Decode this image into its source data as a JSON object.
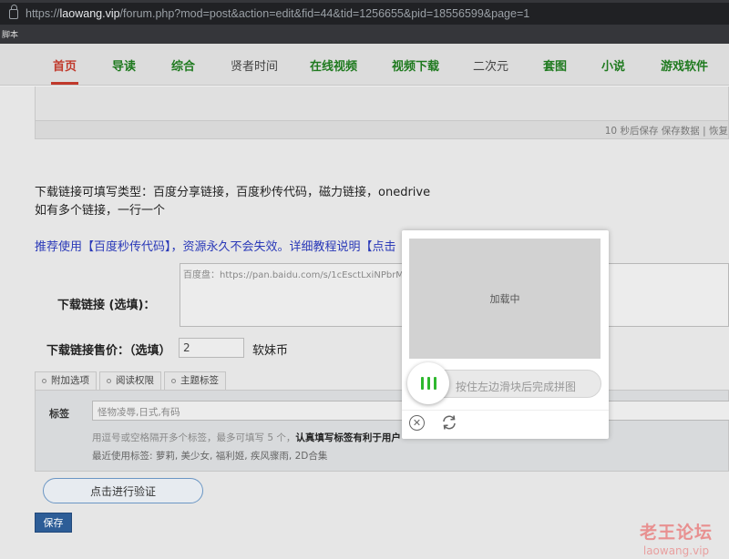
{
  "browser": {
    "url_host": "laowang.vip",
    "url_scheme": "https://",
    "url_rest": "/forum.php?mod=post&action=edit&fid=44&tid=1256655&pid=18556599&page=1",
    "bookmark_text": "脚本"
  },
  "nav": {
    "items": [
      {
        "label": "首页"
      },
      {
        "label": "导读"
      },
      {
        "label": "综合"
      },
      {
        "label": "贤者时间"
      },
      {
        "label": "在线视频"
      },
      {
        "label": "视频下载"
      },
      {
        "label": "二次元"
      },
      {
        "label": "套图"
      },
      {
        "label": "小说"
      },
      {
        "label": "游戏软件"
      }
    ]
  },
  "editor": {
    "save_status": "10 秒后保存 保存数据 | 恢复"
  },
  "download": {
    "types_text": "下载链接可填写类型：百度分享链接，百度秒传代码，磁力链接，onedrive",
    "multi_text": "如有多个链接，一行一个",
    "recommend_text": "推荐使用【百度秒传代码】，资源永久不会失效。详细教程说明【点击",
    "link_label": "下载链接 (选填)：",
    "link_placeholder": "百度盘：https://pan.baidu.com/s/1cEsctLxiNPbrM2-r",
    "price_label": "下载链接售价：（选填）",
    "price_value": "2",
    "price_unit": "软妹币"
  },
  "tabs": [
    {
      "label": "附加选项"
    },
    {
      "label": "阅读权限"
    },
    {
      "label": "主题标签"
    }
  ],
  "tags": {
    "label": "标签",
    "value": "怪物凌辱,日式,有码",
    "hint_plain": "用逗号或空格隔开多个标签，最多可填写 5 个，",
    "hint_bold": "认真填写标签有利于用户",
    "recent": "最近使用标签: 萝莉, 美少女, 福利姬, 疾风骤雨, 2D合集"
  },
  "buttons": {
    "verify": "点击进行验证",
    "save": "保存"
  },
  "watermark": {
    "line1": "老王论坛",
    "line2": "laowang.vip"
  },
  "captcha": {
    "loading_text": "加载中",
    "slider_text": "按住左边滑块后完成拼图",
    "accent": "#2eb82e"
  }
}
